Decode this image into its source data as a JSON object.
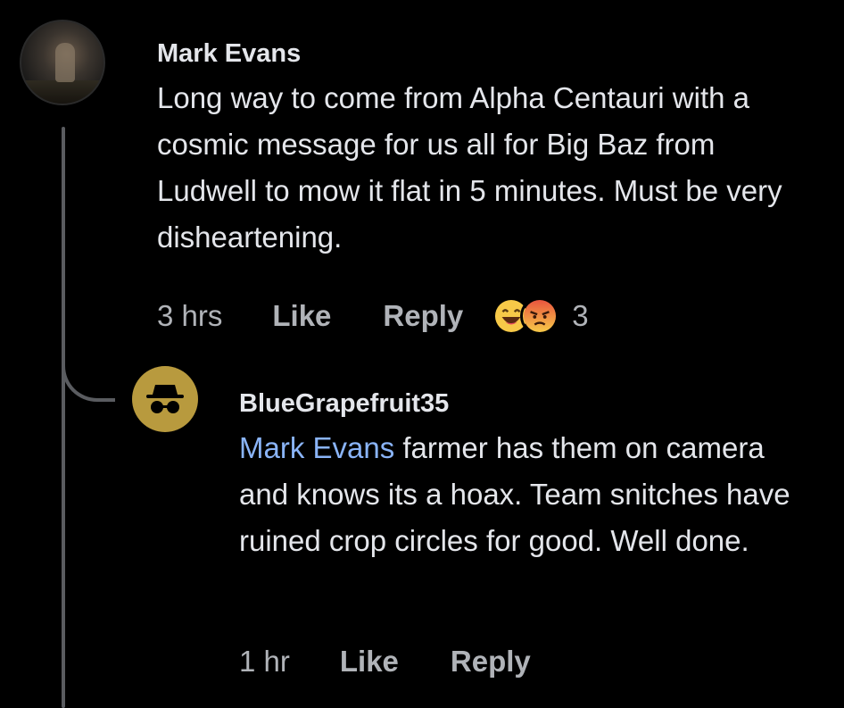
{
  "comment": {
    "author": "Mark Evans",
    "text": "Long way to come from Alpha Centauri with a cosmic message for us all for Big Baz from Ludwell to mow it flat in 5 minutes. Must be very disheartening.",
    "time": "3 hrs",
    "like_label": "Like",
    "reply_label": "Reply",
    "reactions": [
      "haha-icon",
      "angry-icon"
    ],
    "reaction_count": "3"
  },
  "reply": {
    "author": "BlueGrapefruit35",
    "mention": "Mark Evans",
    "text": " farmer has them on camera and knows its a hoax. Team snitches have ruined crop circles for good. Well done.",
    "time": "1 hr",
    "like_label": "Like",
    "reply_label": "Reply",
    "avatar_icon": "anonymous-incognito-icon"
  },
  "colors": {
    "background": "#000000",
    "text": "#e4e6eb",
    "muted": "#b0b3b8",
    "mention": "#8ab4f8",
    "anon_avatar": "#b89a3e"
  }
}
